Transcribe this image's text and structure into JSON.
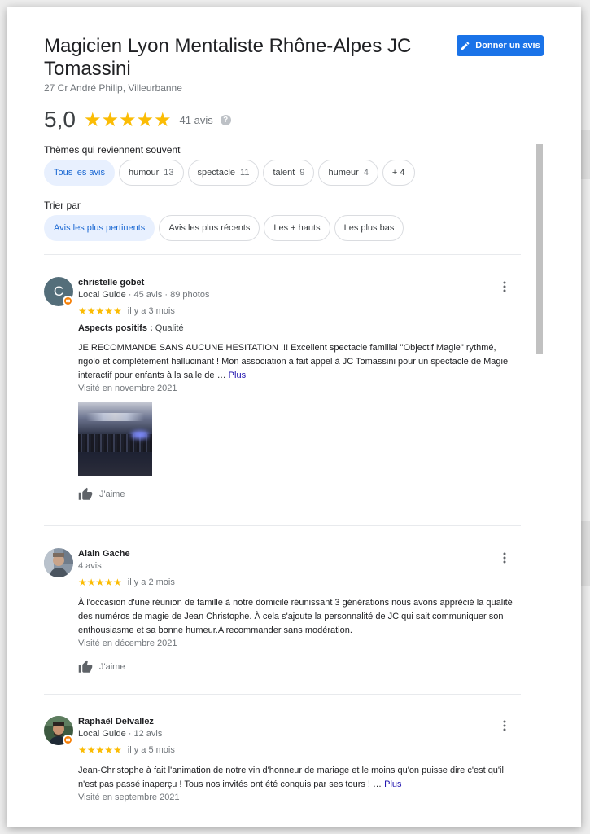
{
  "place": {
    "title": "Magicien Lyon Mentaliste Rhône-Alpes JC Tomassini",
    "address": "27 Cr André Philip, Villeurbanne"
  },
  "give_review_label": "Donner un avis",
  "rating": {
    "score": "5,0",
    "stars": "★★★★★",
    "count": "41 avis",
    "help_glyph": "?"
  },
  "topics": {
    "label": "Thèmes qui reviennent souvent",
    "chips": [
      {
        "label": "Tous les avis",
        "count": ""
      },
      {
        "label": "humour",
        "count": "13"
      },
      {
        "label": "spectacle",
        "count": "11"
      },
      {
        "label": "talent",
        "count": "9"
      },
      {
        "label": "humeur",
        "count": "4"
      },
      {
        "label": "+ 4",
        "count": ""
      }
    ]
  },
  "sort": {
    "label": "Trier par",
    "chips": [
      {
        "label": "Avis les plus pertinents"
      },
      {
        "label": "Avis les plus récents"
      },
      {
        "label": "Les + hauts"
      },
      {
        "label": "Les plus bas"
      }
    ]
  },
  "reviews": [
    {
      "avatar_letter": "C",
      "name": "christelle gobet",
      "guide": "Local Guide",
      "meta": " · 45 avis · 89 photos",
      "stars": "★★★★★",
      "ago": "il y a 3 mois",
      "aspects_label": "Aspects positifs :",
      "aspects_value": " Qualité",
      "text": "JE RECOMMANDE SANS AUCUNE HESITATION !!! Excellent spectacle familial \"Objectif Magie\" rythmé, rigolo et complètement hallucinant ! Mon association a fait appel à JC Tomassini pour un spectacle de Magie interactif pour enfants à la salle de … ",
      "more": "Plus",
      "visit": "Visité en novembre 2021",
      "like": "J'aime"
    },
    {
      "name": "Alain Gache",
      "meta": "4 avis",
      "stars": "★★★★★",
      "ago": "il y a 2 mois",
      "text": "À l'occasion d'une réunion de famille à notre domicile réunissant 3 générations nous avons apprécié la qualité des numéros de magie de Jean Christophe. À cela s'ajoute la personnalité de JC qui sait communiquer son enthousiasme et sa bonne humeur.A recommander sans modération.",
      "visit": "Visité en décembre 2021",
      "like": "J'aime"
    },
    {
      "name": "Raphaël Delvallez",
      "guide": "Local Guide",
      "meta": " · 12 avis",
      "stars": "★★★★★",
      "ago": "il y a 5 mois",
      "text": "Jean-Christophe à fait l'animation de notre vin d'honneur de mariage et le moins qu'on puisse dire c'est qu'il n'est pas passé inaperçu ! Tous nos invités ont été conquis par ses tours ! … ",
      "more": "Plus",
      "visit": "Visité en septembre 2021"
    }
  ],
  "colors": {
    "accent": "#1a73e8",
    "star": "#fbbc04",
    "badge": "#f57c00",
    "active_chip_bg": "#e8f0fe"
  }
}
